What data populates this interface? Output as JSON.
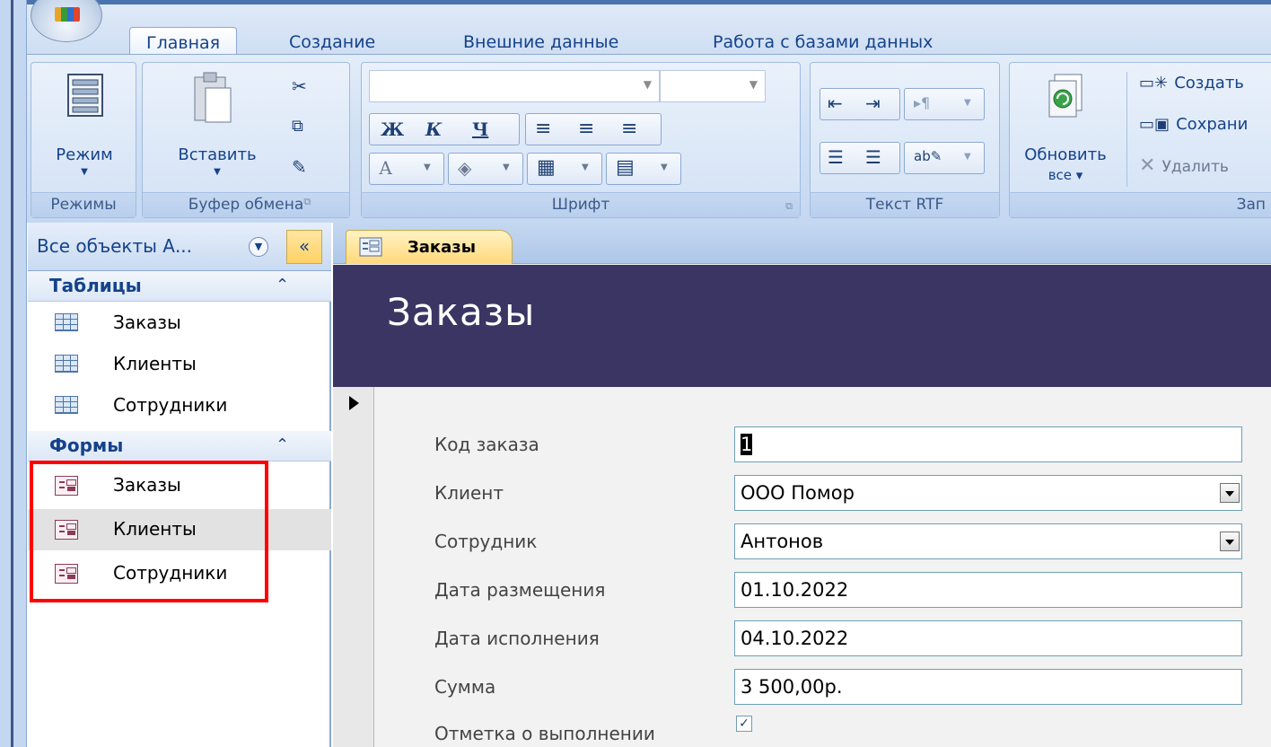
{
  "ribbon": {
    "tabs": [
      {
        "label": "Главная",
        "active": true
      },
      {
        "label": "Создание",
        "active": false
      },
      {
        "label": "Внешние данные",
        "active": false
      },
      {
        "label": "Работа с базами данных",
        "active": false
      }
    ],
    "groups": {
      "views": {
        "label": "Режимы",
        "mode_button": "Режим"
      },
      "clipboard": {
        "label": "Буфер обмена",
        "paste_button": "Вставить"
      },
      "font": {
        "label": "Шрифт",
        "bold": "Ж",
        "italic": "К",
        "underline": "Ч",
        "font_color": "А"
      },
      "rtf": {
        "label": "Текст RTF"
      },
      "records": {
        "label": "Зап",
        "refresh_line1": "Обновить",
        "refresh_line2": "все ▾",
        "new": "Создать",
        "save": "Сохрани",
        "delete": "Удалить"
      }
    }
  },
  "nav": {
    "title": "Все объекты А...",
    "collapse_glyph": "«",
    "sections": [
      {
        "label": "Таблицы",
        "items": [
          {
            "label": "Заказы"
          },
          {
            "label": "Клиенты"
          },
          {
            "label": "Сотрудники"
          }
        ]
      },
      {
        "label": "Формы",
        "items": [
          {
            "label": "Заказы"
          },
          {
            "label": "Клиенты"
          },
          {
            "label": "Сотрудники"
          }
        ]
      }
    ]
  },
  "document": {
    "tab_label": "Заказы",
    "form_title": "Заказы",
    "fields": [
      {
        "label": "Код заказа",
        "value": "1"
      },
      {
        "label": "Клиент",
        "value": "ООО Помор"
      },
      {
        "label": "Сотрудник",
        "value": "Антонов"
      },
      {
        "label": "Дата размещения",
        "value": "01.10.2022"
      },
      {
        "label": "Дата исполнения",
        "value": "04.10.2022"
      },
      {
        "label": "Сумма",
        "value": "3 500,00р."
      },
      {
        "label": "Отметка о выполнении",
        "checked": true
      }
    ]
  },
  "colors": {
    "accent_header": "#3b3564",
    "highlight_border": "#ff0000",
    "ribbon_text": "#15428b"
  }
}
